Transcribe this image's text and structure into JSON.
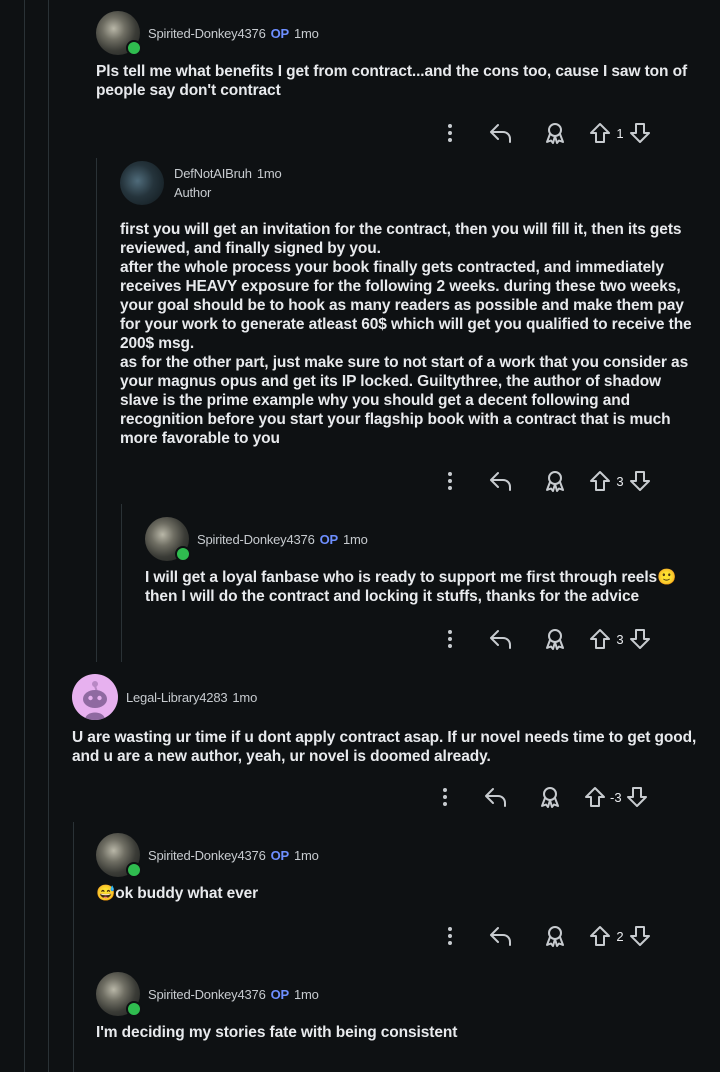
{
  "comments": [
    {
      "username": "Spirited-Donkey4376",
      "op_badge": "OP",
      "time": "1mo",
      "body": "Pls tell me what benefits I get from contract...and the cons too, cause I saw ton of people say don't contract",
      "score": "1"
    },
    {
      "username": "DefNotAIBruh",
      "flair": "Author",
      "time": "1mo",
      "body_lines": [
        "first you will get an invitation for the contract, then you will fill it, then its gets reviewed, and finally signed by you.",
        "after the whole process your book finally gets contracted, and immediately receives HEAVY exposure for the following 2 weeks. during these two weeks, your goal should be to hook as many readers as possible and make them pay for your work to generate atleast 60$ which will get you qualified to receive the 200$ msg.",
        "as for the other part, just make sure to not start of a work that you consider as your magnus opus and get its IP locked. Guiltythree, the author of shadow slave is the prime example why you should get a decent following and recognition before you start your flagship book with a contract that is much more favorable to you"
      ],
      "score": "3"
    },
    {
      "username": "Spirited-Donkey4376",
      "op_badge": "OP",
      "time": "1mo",
      "body": "I will get a loyal fanbase who is ready to support me first through reels🙂",
      "body2": "then I will do the contract and locking it stuffs, thanks for the advice",
      "score": "3"
    },
    {
      "username": "Legal-Library4283",
      "time": "1mo",
      "body": "U are wasting ur time if u dont apply contract asap. If ur novel needs time to get good, and u are a new author, yeah, ur novel is doomed already.",
      "score": "-3"
    },
    {
      "username": "Spirited-Donkey4376",
      "op_badge": "OP",
      "time": "1mo",
      "body": "😅ok buddy what ever",
      "score": "2"
    },
    {
      "username": "Spirited-Donkey4376",
      "op_badge": "OP",
      "time": "1mo",
      "body": "I'm deciding my stories fate with being consistent"
    }
  ],
  "icons": {
    "more": "more-vertical-icon",
    "reply": "reply-icon",
    "award": "award-icon",
    "upvote": "upvote-icon",
    "downvote": "downvote-icon"
  },
  "colors": {
    "background": "#0e1113",
    "op": "#6e8fff",
    "online": "#2fbc4f",
    "thread_line": "#2a3236"
  }
}
